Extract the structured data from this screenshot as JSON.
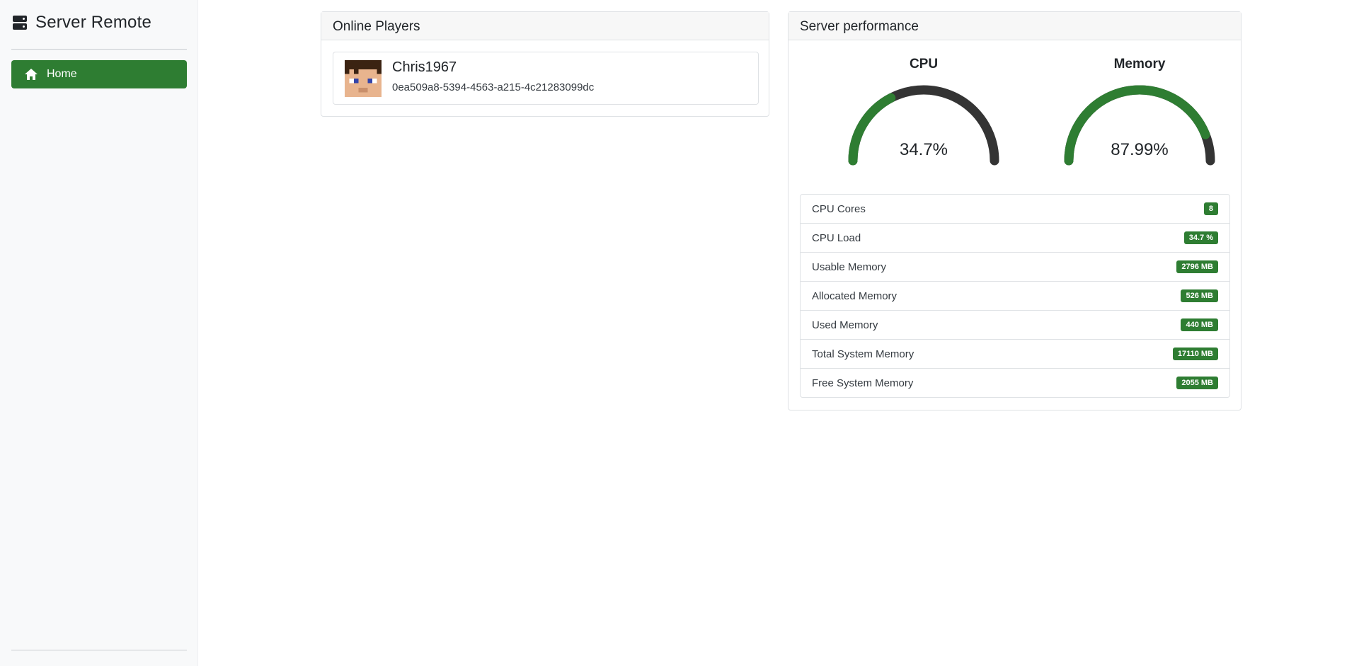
{
  "app": {
    "title": "Server Remote",
    "brand_icon": "server-icon"
  },
  "sidebar": {
    "items": [
      {
        "label": "Home",
        "icon": "home-icon",
        "active": true
      }
    ]
  },
  "players": {
    "title": "Online Players",
    "list": [
      {
        "name": "Chris1967",
        "uuid": "0ea509a8-5394-4563-a215-4c21283099dc"
      }
    ]
  },
  "performance": {
    "title": "Server performance",
    "gauges": {
      "cpu": {
        "label": "CPU",
        "value_text": "34.7%",
        "fraction": 0.347
      },
      "memory": {
        "label": "Memory",
        "value_text": "87.99%",
        "fraction": 0.8799
      }
    },
    "stats": [
      {
        "label": "CPU Cores",
        "value": "8"
      },
      {
        "label": "CPU Load",
        "value": "34.7 %"
      },
      {
        "label": "Usable Memory",
        "value": "2796 MB"
      },
      {
        "label": "Allocated Memory",
        "value": "526 MB"
      },
      {
        "label": "Used Memory",
        "value": "440 MB"
      },
      {
        "label": "Total System Memory",
        "value": "17110 MB"
      },
      {
        "label": "Free System Memory",
        "value": "2055 MB"
      }
    ]
  },
  "colors": {
    "accent": "#2e7d32",
    "gauge_track": "#343434",
    "sidebar_bg": "#f8f9fa"
  }
}
